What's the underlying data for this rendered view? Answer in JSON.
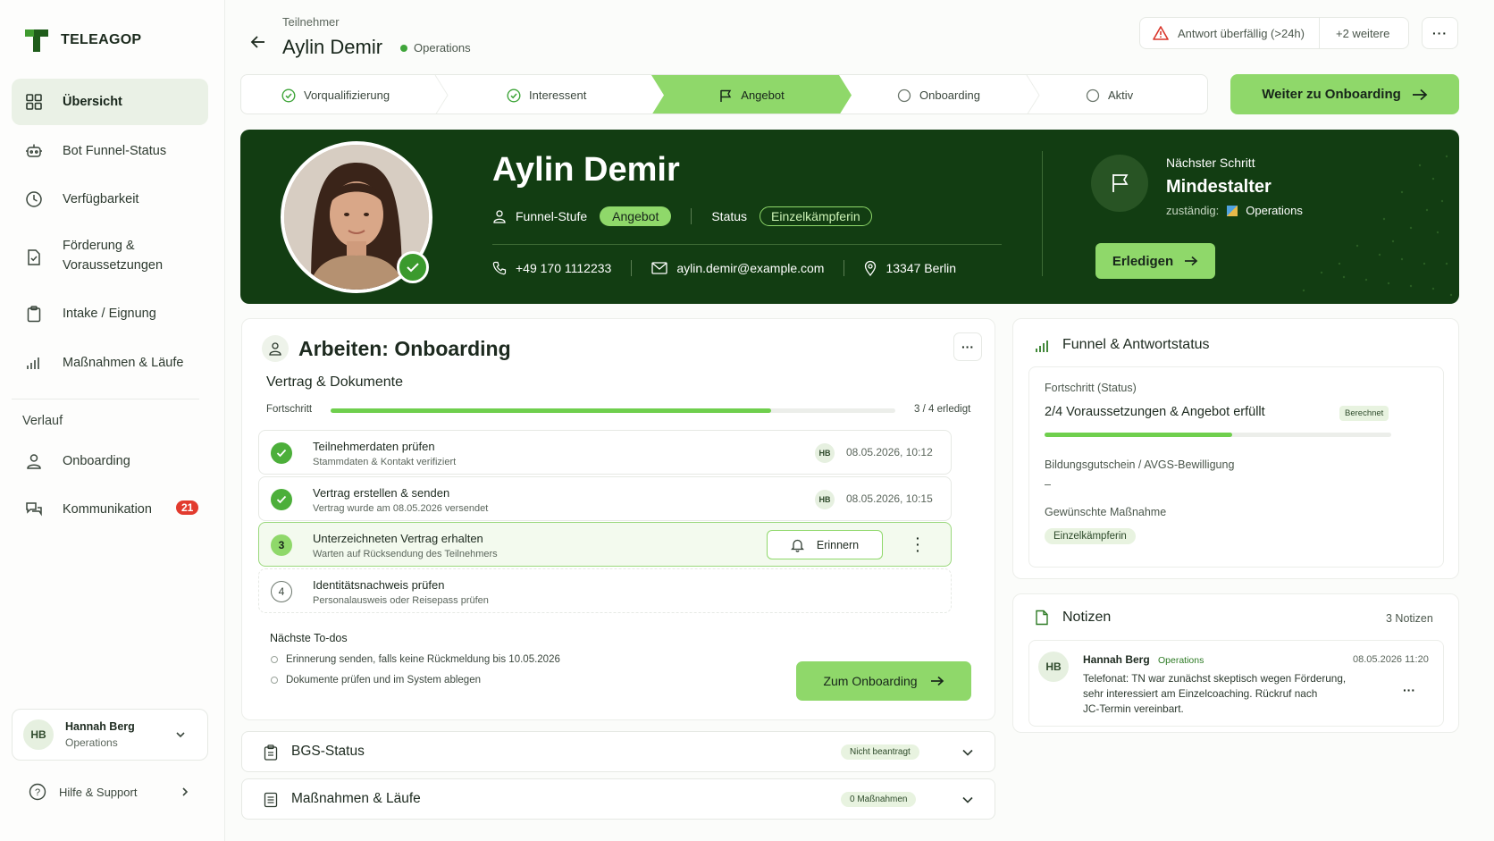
{
  "brand": {
    "name": "TELEAGOP",
    "accent": "#8fd86a",
    "dark": "#123d12"
  },
  "sidebar": {
    "items": [
      {
        "label": "Übersicht",
        "icon": "grid-icon",
        "active": true
      },
      {
        "label": "Bot Funnel-Status",
        "icon": "robot-icon"
      },
      {
        "label": "Verfügbarkeit",
        "icon": "clock-icon"
      },
      {
        "label": "Förderung &",
        "label2": "Voraussetzungen",
        "icon": "document-check-icon"
      },
      {
        "label": "Intake / Eignung",
        "icon": "clipboard-icon"
      },
      {
        "label": "Maßnahmen & Läufe",
        "icon": "bar-chart-icon"
      }
    ],
    "section_label": "Verlauf",
    "history": [
      {
        "label": "Onboarding",
        "icon": "user-icon"
      },
      {
        "label": "Kommunikation",
        "icon": "chat-icon",
        "badge": "21"
      }
    ],
    "user": {
      "initials": "HB",
      "name": "Hannah Berg",
      "team": "Operations"
    },
    "help_label": "Hilfe & Support"
  },
  "header": {
    "subtitle": "Teilnehmer",
    "title": "Aylin Demir",
    "team": "Operations",
    "alert": "Antwort überfällig (>24h)",
    "alert_more": "+2 weitere"
  },
  "stepper": {
    "steps": [
      {
        "label": "Vorqualifizierung",
        "state": "done"
      },
      {
        "label": "Interessent",
        "state": "done"
      },
      {
        "label": "Angebot",
        "state": "current"
      },
      {
        "label": "Onboarding",
        "state": "todo"
      },
      {
        "label": "Aktiv",
        "state": "todo"
      }
    ],
    "cta_label": "Weiter zu Onboarding"
  },
  "hero": {
    "name": "Aylin Demir",
    "funnel_label": "Funnel-Stufe",
    "funnel_value": "Angebot",
    "status_label": "Status",
    "status_value": "Einzelkämpferin",
    "phone": "+49 170 1112233",
    "email": "aylin.demir@example.com",
    "location": "13347 Berlin",
    "next_step_label": "Nächster Schritt",
    "next_step_value": "Mindestalter",
    "owner_label": "zuständig:",
    "owner_value": "Operations",
    "done_button": "Erledigen"
  },
  "work": {
    "title": "Arbeiten: Onboarding",
    "section": "Vertrag & Dokumente",
    "progress_label": "Fortschritt",
    "progress_value": 0.78,
    "progress_text": "3 / 4 erledigt",
    "tasks": [
      {
        "num": "",
        "title": "Teilnehmerdaten prüfen",
        "sub": "Stammdaten & Kontakt verifiziert",
        "user": "HB",
        "time": "08.05.2026, 10:12",
        "state": "done"
      },
      {
        "num": "",
        "title": "Vertrag erstellen & senden",
        "sub": "Vertrag wurde am 08.05.2026 versendet",
        "user": "HB",
        "time": "08.05.2026, 10:15",
        "state": "done"
      },
      {
        "num": "3",
        "title": "Unterzeichneten Vertrag erhalten",
        "sub": "Warten auf Rücksendung des Teilnehmers",
        "action": "Erinnern",
        "state": "current"
      },
      {
        "num": "4",
        "title": "Identitätsnachweis prüfen",
        "sub": "Personalausweis oder Reisepass prüfen",
        "state": "todo"
      }
    ],
    "todos_title": "Nächste To-dos",
    "todos": [
      "Erinnerung senden, falls keine Rückmeldung bis 10.05.2026",
      "Dokumente prüfen und im System ablegen"
    ],
    "cta_label": "Zum Onboarding"
  },
  "accordions": [
    {
      "title": "BGS-Status",
      "badge": "Nicht beantragt"
    },
    {
      "title": "Maßnahmen & Läufe",
      "badge": "0 Maßnahmen"
    }
  ],
  "funnel": {
    "title": "Funnel & Antwortstatus",
    "progress_label": "Fortschritt (Status)",
    "progress_value_text": "2/4 Voraussetzungen & Angebot erfüllt",
    "computed_badge": "Berechnet",
    "progress_fraction": 0.54,
    "voucher_label": "Bildungsgutschein / AVGS-Bewilligung",
    "voucher_value": "–",
    "measure_label": "Gewünschte Maßnahme",
    "measure_value": "Einzelkämpferin"
  },
  "notes": {
    "title": "Notizen",
    "count": "3 Notizen",
    "items": [
      {
        "initials": "HB",
        "author": "Hannah Berg",
        "team": "Operations",
        "time": "08.05.2026 11:20",
        "line1": "Telefonat: TN war zunächst skeptisch wegen Förderung,",
        "line2": "sehr interessiert am Einzelcoaching. Rückruf nach",
        "line3": "JC-Termin vereinbart."
      }
    ]
  }
}
